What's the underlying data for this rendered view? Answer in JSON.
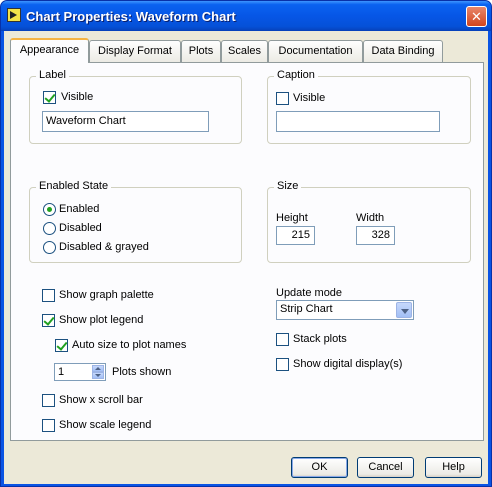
{
  "window": {
    "title": "Chart Properties: Waveform Chart",
    "close_glyph": "✕"
  },
  "tabs": [
    {
      "label": "Appearance",
      "active": true
    },
    {
      "label": "Display Format"
    },
    {
      "label": "Plots"
    },
    {
      "label": "Scales"
    },
    {
      "label": "Documentation"
    },
    {
      "label": "Data Binding"
    }
  ],
  "label_group": {
    "title": "Label",
    "visible_label": "Visible",
    "visible_checked": true,
    "text_value": "Waveform Chart"
  },
  "caption_group": {
    "title": "Caption",
    "visible_label": "Visible",
    "visible_checked": false,
    "text_value": ""
  },
  "enabled_state": {
    "title": "Enabled State",
    "options": [
      "Enabled",
      "Disabled",
      "Disabled & grayed"
    ],
    "selected": "Enabled"
  },
  "size_group": {
    "title": "Size",
    "height_label": "Height",
    "height_value": "215",
    "width_label": "Width",
    "width_value": "328"
  },
  "options": {
    "show_graph_palette": "Show graph palette",
    "show_plot_legend": "Show plot legend",
    "auto_size": "Auto size to plot names",
    "plots_shown_value": "1",
    "plots_shown_label": "Plots shown",
    "show_x_scroll_bar": "Show x scroll bar",
    "show_scale_legend": "Show scale legend"
  },
  "update": {
    "label": "Update mode",
    "selected": "Strip Chart",
    "stack_plots": "Stack plots",
    "show_digital_display": "Show digital display(s)"
  },
  "buttons": {
    "ok": "OK",
    "cancel": "Cancel",
    "help": "Help"
  }
}
